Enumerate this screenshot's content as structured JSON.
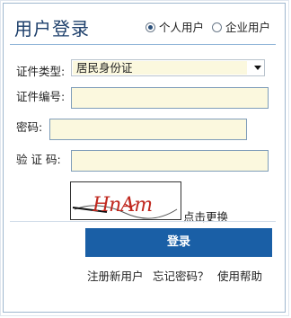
{
  "header": {
    "title": "用户登录",
    "user_types": [
      {
        "label": "个人用户",
        "selected": true
      },
      {
        "label": "企业用户",
        "selected": false
      }
    ]
  },
  "form": {
    "id_type_label": "证件类型:",
    "id_type_value": "居民身份证",
    "id_number_label": "证件编号:",
    "id_number_value": "",
    "password_label": "密码:",
    "password_value": "",
    "captcha_label": "验 证 码:",
    "captcha_value": "",
    "captcha_text": "HnAm",
    "refresh_label": "点击更换"
  },
  "actions": {
    "login_label": "登录",
    "register_label": "注册新用户",
    "forgot_label": "忘记密码？",
    "help_label": "使用帮助"
  },
  "colors": {
    "accent": "#1a5fa6",
    "title": "#1d3f6b",
    "field_bg": "#fbf8de",
    "captcha_red": "#c0281f"
  }
}
